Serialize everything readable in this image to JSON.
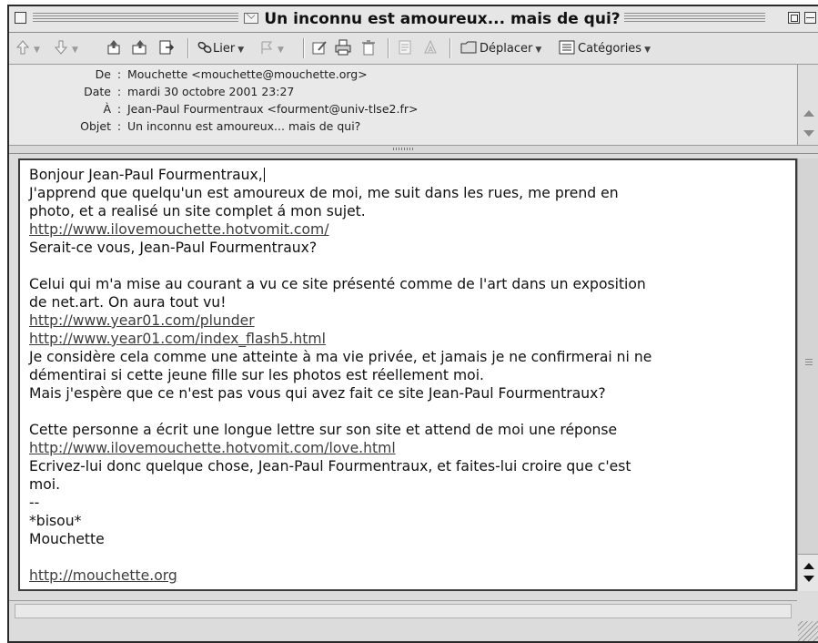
{
  "window": {
    "title": "Un inconnu est amoureux... mais de qui?"
  },
  "toolbar": {
    "link_label": "Lier",
    "move_label": "Déplacer",
    "categories_label": "Catégories"
  },
  "headers": [
    {
      "label": "De",
      "value": "Mouchette <mouchette@mouchette.org>"
    },
    {
      "label": "Date",
      "value": "mardi 30 octobre 2001 23:27"
    },
    {
      "label": "À",
      "value": "Jean-Paul Fourmentraux <fourment@univ-tlse2.fr>"
    },
    {
      "label": "Objet",
      "value": "Un inconnu est amoureux... mais de qui?"
    }
  ],
  "body": {
    "l1": "Bonjour Jean-Paul Fourmentraux,",
    "l2": "J'apprend que quelqu'un est amoureux de moi, me suit dans les rues, me prend en",
    "l3": "photo, et a realisé un site complet á mon sujet.",
    "l4": "http://www.ilovemouchette.hotvomit.com/",
    "l5": "Serait-ce vous, Jean-Paul Fourmentraux?",
    "l7": "Celui qui m'a mise au courant a vu ce site présenté comme de l'art dans un exposition",
    "l8": "de net.art. On aura tout vu!",
    "l9": "http://www.year01.com/plunder",
    "l10": "http://www.year01.com/index_flash5.html",
    "l11": "Je considère cela comme une atteinte à ma vie privée, et jamais je ne confirmerai ni ne",
    "l12": "démentirai si cette jeune fille sur les photos est réellement moi.",
    "l13": "Mais j'espère que ce n'est pas vous qui avez fait ce site Jean-Paul Fourmentraux?",
    "l15": "Cette personne a écrit une longue lettre sur son site et attend de moi une réponse",
    "l16": "http://www.ilovemouchette.hotvomit.com/love.html",
    "l17": "Ecrivez-lui donc quelque chose, Jean-Paul Fourmentraux, et faites-lui croire que c'est",
    "l18": "moi.",
    "l19": "--",
    "l20": "*bisou*",
    "l21": "Mouchette",
    "l23": "http://mouchette.org"
  }
}
